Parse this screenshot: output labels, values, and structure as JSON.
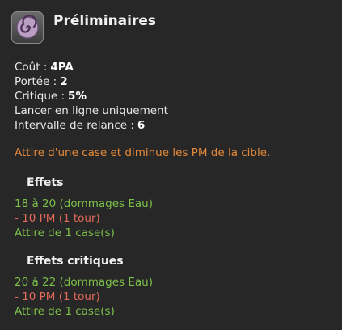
{
  "spell": {
    "title": "Préliminaires",
    "icon": "spiral-spell-icon"
  },
  "stats": [
    {
      "label": "Coût :",
      "value": "4PA"
    },
    {
      "label": "Portée :",
      "value": "2"
    },
    {
      "label": "Critique :",
      "value": "5%"
    },
    {
      "label": "Lancer en ligne uniquement",
      "value": ""
    },
    {
      "label": "Intervalle de relance :",
      "value": "6"
    }
  ],
  "description": "Attire d'une case et diminue les PM de la cible.",
  "effects": {
    "title": "Effets",
    "lines": [
      "18 à 20 (dommages Eau)",
      "- 10 PM (1 tour)",
      "Attire de 1 case(s)"
    ]
  },
  "critical_effects": {
    "title": "Effets critiques",
    "lines": [
      "20 à 22 (dommages Eau)",
      "- 10 PM (1 tour)",
      "Attire de 1 case(s)"
    ]
  },
  "colors": {
    "background": "#272727",
    "description": "#e58a3a",
    "positive_effect": "#7cc04a",
    "negative_effect": "#e36a5a"
  }
}
